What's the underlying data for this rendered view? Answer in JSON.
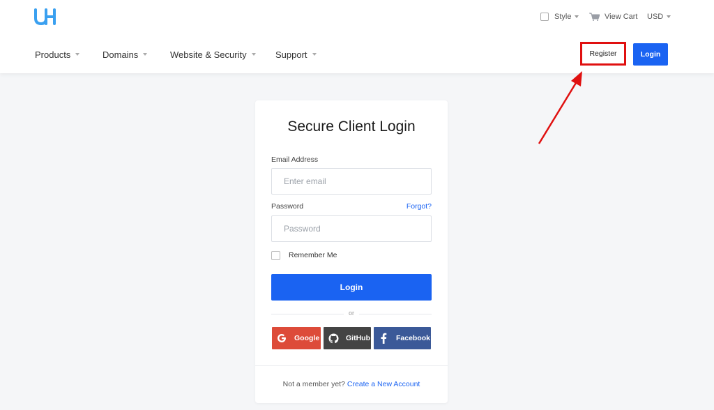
{
  "header": {
    "logo_icon": "uh-logo-icon",
    "style_label": "Style",
    "view_cart_label": "View Cart",
    "currency_label": "USD",
    "nav": [
      {
        "label": "Products"
      },
      {
        "label": "Domains"
      },
      {
        "label": "Website & Security"
      },
      {
        "label": "Support"
      }
    ],
    "register_label": "Register",
    "login_label": "Login",
    "highlight_color": "#e01010"
  },
  "login_card": {
    "title": "Secure Client Login",
    "email_label": "Email Address",
    "email_placeholder": "Enter email",
    "email_value": "",
    "password_label": "Password",
    "password_placeholder": "Password",
    "password_value": "",
    "forgot_label": "Forgot?",
    "remember_label": "Remember Me",
    "login_button": "Login",
    "or_label": "or",
    "social": {
      "google": "Google",
      "github": "GitHub",
      "facebook": "Facebook"
    },
    "footer_prefix": "Not a member yet?",
    "footer_link": "Create a New Account"
  },
  "colors": {
    "accent": "#1a63f2",
    "google": "#dd4b39",
    "github": "#444444",
    "facebook": "#3b5998"
  }
}
